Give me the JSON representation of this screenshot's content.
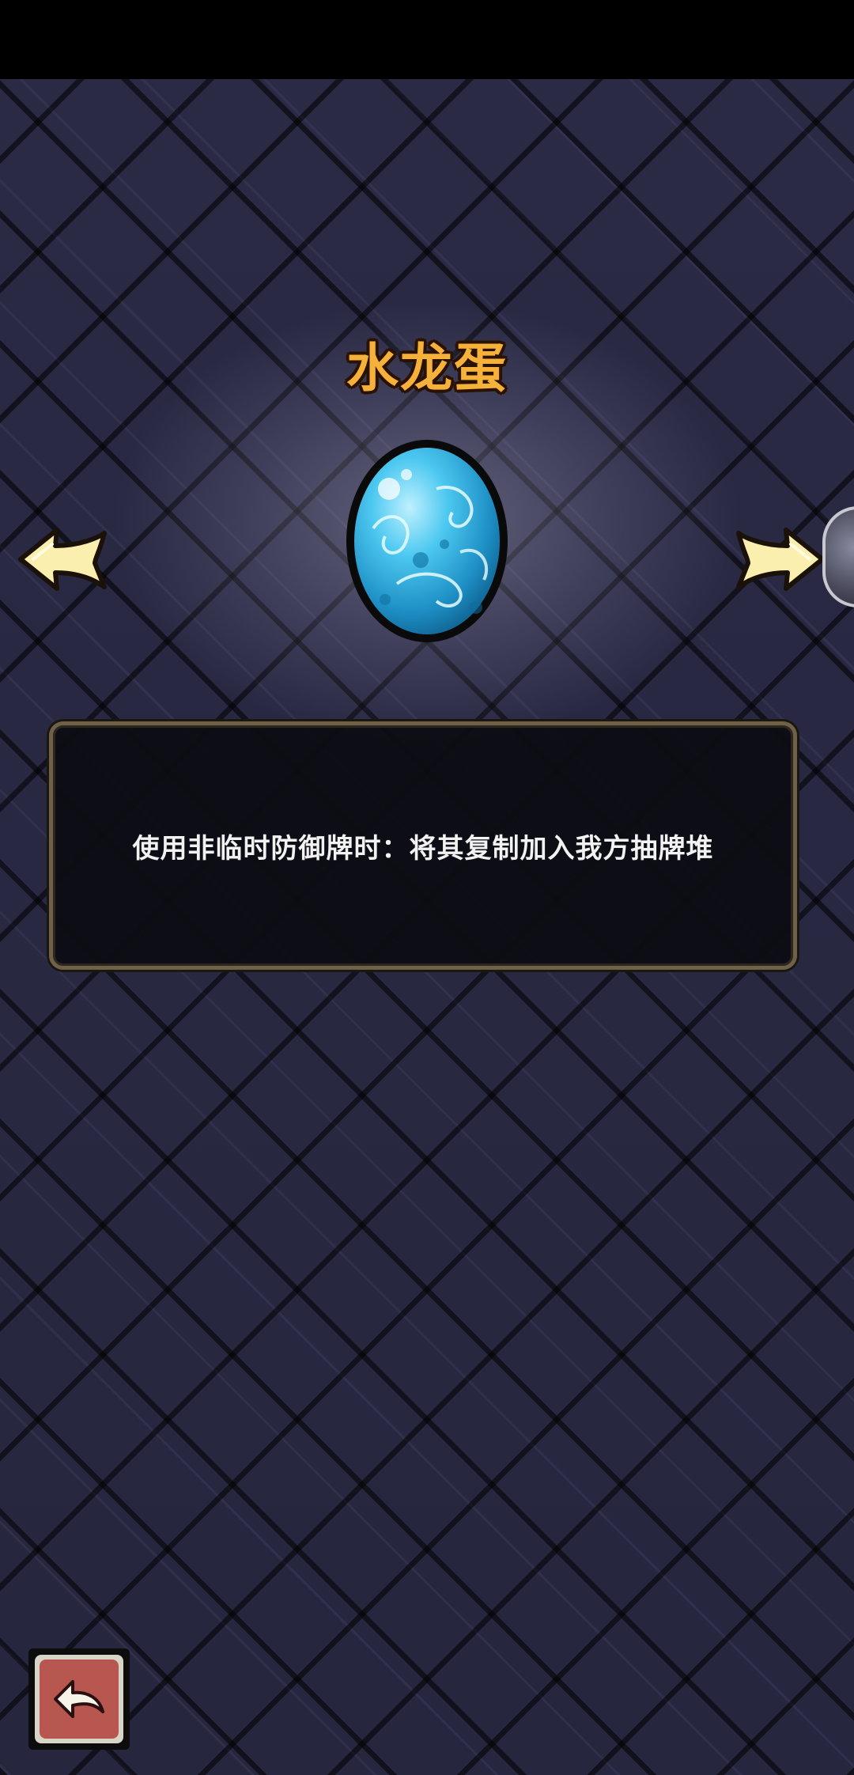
{
  "item": {
    "name": "水龙蛋",
    "description": "使用非临时防御牌时：将其复制加入我方抽牌堆"
  },
  "navigation": {
    "prev_icon": "arrow-left-icon",
    "next_icon": "arrow-right-icon",
    "back_icon": "return-icon"
  },
  "colors": {
    "title": "#f6b13a",
    "panel_border": "#6e6148",
    "egg_main": "#35b6e6",
    "arrow_fill": "#fbefb0",
    "back_button": "#b8574f"
  }
}
